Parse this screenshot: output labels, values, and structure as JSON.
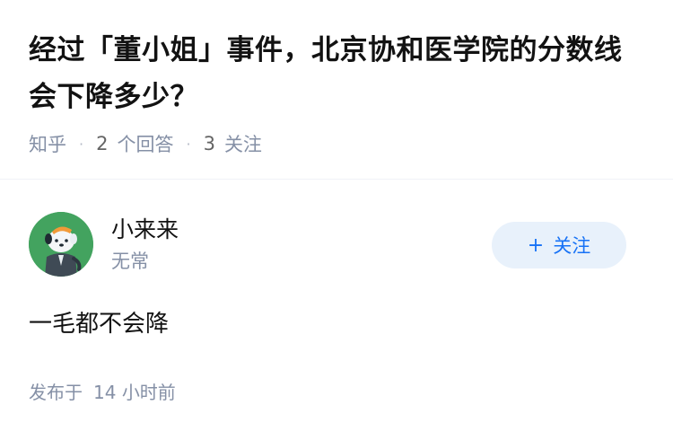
{
  "question": {
    "title": "经过「董小姐」事件，北京协和医学院的分数线会下降多少？",
    "meta": {
      "source": "知乎",
      "answer_count": "2",
      "answer_label": "个回答",
      "follower_count": "3",
      "follower_label": "关注",
      "separator": "·"
    }
  },
  "answer": {
    "author": {
      "name": "小来来",
      "bio": "无常",
      "avatar_icon": "cartoon-character-avatar-icon"
    },
    "follow_button": {
      "icon": "+",
      "label": "关注"
    },
    "content": "一毛都不会降",
    "published": {
      "label": "发布于",
      "value": "14",
      "unit": "小时前"
    }
  },
  "colors": {
    "brand_blue": "#1772f6",
    "follow_bg": "#e8f1fb",
    "meta_gray": "#8590a6",
    "avatar_green": "#43a35f"
  }
}
